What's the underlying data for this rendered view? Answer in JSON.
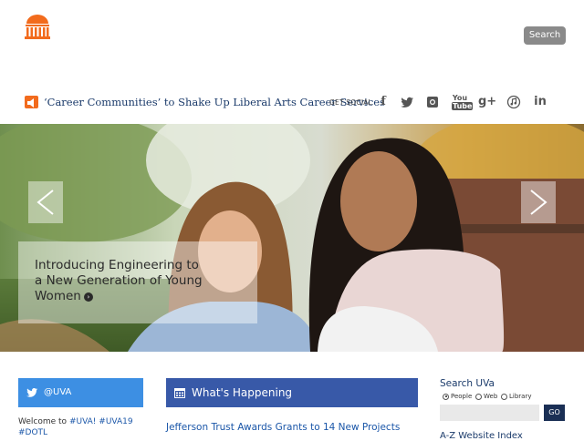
{
  "header": {
    "search_label": "Search"
  },
  "ticker": {
    "headline": "‘Career Communities’ to Shake Up Liberal Arts Career Services",
    "get_social": "GET SOCIAL",
    "social_icons": [
      "facebook-icon",
      "twitter-icon",
      "instagram-icon",
      "youtube-icon",
      "google-plus-icon",
      "itunes-icon",
      "linkedin-icon"
    ],
    "social_glyphs": [
      "f",
      "🐦",
      "◘",
      "You",
      "g+",
      "♫",
      "in"
    ]
  },
  "hero": {
    "caption": "Introducing Engineering to a New Generation of Young Women"
  },
  "twitter": {
    "handle": "@UVA",
    "text_prefix": "Welcome to ",
    "tags": [
      "#UVA!",
      "#UVA19",
      "#DOTL"
    ]
  },
  "whats_happening": {
    "title": "What's Happening",
    "link": "Jefferson Trust Awards Grants to 14 New Projects"
  },
  "search_uva": {
    "title": "Search UVa",
    "options": [
      "People",
      "Web",
      "Library"
    ],
    "selected": "People",
    "go_label": "GO",
    "az_label": "A-Z Website Index"
  },
  "colors": {
    "brand_orange": "#f26b1d",
    "twitter_blue": "#3d8fe3",
    "happening_blue": "#3859a8",
    "navy": "#1a2f55"
  }
}
